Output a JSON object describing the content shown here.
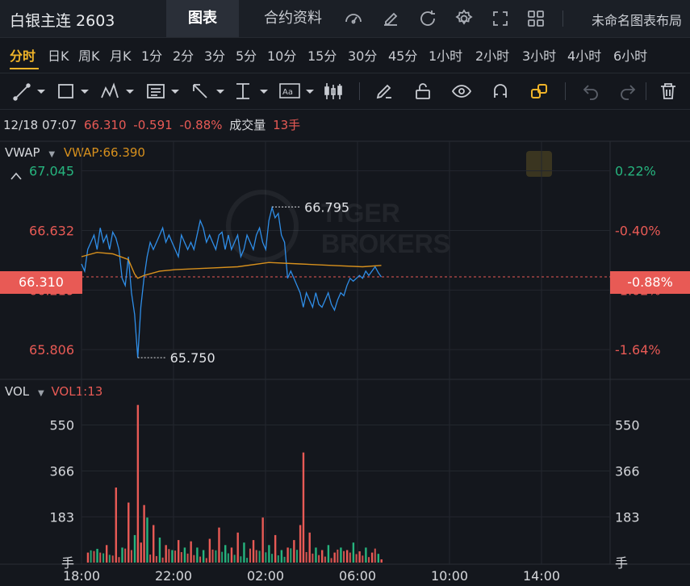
{
  "header": {
    "title": "白银主连 2603",
    "tabs": [
      {
        "label": "图表"
      },
      {
        "label": "合约资料"
      }
    ],
    "toolbar_icons": [
      "gauge-icon",
      "edit-icon",
      "refresh-icon",
      "settings-icon",
      "fullscreen-icon",
      "grid-icon"
    ],
    "layout_name": "未命名图表布局"
  },
  "timeframes": [
    "分时",
    "日K",
    "周K",
    "月K",
    "1分",
    "2分",
    "3分",
    "5分",
    "10分",
    "15分",
    "30分",
    "45分",
    "1小时",
    "2小时",
    "3小时",
    "4小时",
    "6小时"
  ],
  "active_timeframe": "分时",
  "drawing_tools": [
    "line-tool-icon",
    "rectangle-tool-icon",
    "pattern-tool-icon",
    "text-note-tool-icon",
    "arrow-tool-icon",
    "measure-tool-icon",
    "label-tool-icon",
    "candle-tool-icon",
    "pencil-icon",
    "unlock-icon",
    "eye-icon",
    "magnet-icon",
    "link-icon",
    "undo-icon",
    "redo-icon",
    "trash-icon"
  ],
  "info": {
    "datetime": "12/18 07:07",
    "price": "66.310",
    "change": "-0.591",
    "change_pct": "-0.88%",
    "volume_label": "成交量",
    "volume": "13手"
  },
  "indicators": {
    "main_name": "VWAP",
    "main_value": "VWAP:66.390",
    "vol_name": "VOL",
    "vol_value": "VOL1:13"
  },
  "watermark": {
    "line1": "TIGER",
    "line2": "BROKERS"
  },
  "colors": {
    "up": "#26b47e",
    "down": "#e85a55",
    "price_line": "#2f8ee8",
    "vwap_line": "#d7901d",
    "accent": "#f0b429",
    "background": "#14171d"
  },
  "chart_data": [
    {
      "type": "line",
      "title": "分时",
      "x_ticks": [
        "18:00",
        "22:00",
        "02:00",
        "06:00",
        "10:00",
        "14:00"
      ],
      "y_ticks_left": [
        "67.045",
        "66.632",
        "66.219",
        "65.806"
      ],
      "y_ticks_right": [
        "0.22%",
        "-0.40%",
        "-1.02%",
        "-1.64%"
      ],
      "ylim": [
        65.6,
        67.25
      ],
      "current_price": "66.310",
      "current_pct": "-0.88%",
      "annotations": [
        {
          "label": "66.795",
          "x": 61,
          "y": 66.795
        },
        {
          "label": "65.750",
          "x": 18,
          "y": 65.75
        }
      ],
      "series": [
        {
          "name": "price",
          "x": [
            0,
            1,
            2,
            3,
            4,
            5,
            6,
            7,
            8,
            9,
            10,
            11,
            12,
            13,
            14,
            15,
            16,
            17,
            18,
            19,
            20,
            21,
            22,
            23,
            24,
            25,
            26,
            27,
            28,
            29,
            30,
            31,
            32,
            33,
            34,
            35,
            36,
            37,
            38,
            39,
            40,
            41,
            42,
            43,
            44,
            45,
            46,
            47,
            48,
            49,
            50,
            51,
            52,
            53,
            54,
            55,
            56,
            57,
            58,
            59,
            60,
            61,
            62,
            63,
            64,
            65,
            66,
            67,
            68,
            69,
            70,
            71,
            72,
            73,
            74,
            75,
            76,
            77,
            78,
            79,
            80,
            81,
            82,
            83,
            84,
            85,
            86,
            87,
            88,
            89,
            90,
            91,
            92,
            93,
            94,
            95,
            96
          ],
          "y": [
            66.4,
            66.35,
            66.5,
            66.55,
            66.6,
            66.5,
            66.65,
            66.55,
            66.6,
            66.5,
            66.62,
            66.58,
            66.5,
            66.3,
            66.25,
            66.45,
            66.2,
            66.05,
            65.75,
            66.1,
            66.3,
            66.45,
            66.55,
            66.5,
            66.55,
            66.6,
            66.65,
            66.55,
            66.6,
            66.55,
            66.5,
            66.45,
            66.6,
            66.55,
            66.5,
            66.55,
            66.5,
            66.6,
            66.7,
            66.65,
            66.55,
            66.6,
            66.55,
            66.5,
            66.6,
            66.62,
            66.5,
            66.6,
            66.5,
            66.55,
            66.6,
            66.45,
            66.5,
            66.6,
            66.55,
            66.5,
            66.6,
            66.65,
            66.55,
            66.5,
            66.7,
            66.79,
            66.72,
            66.75,
            66.6,
            66.55,
            66.3,
            66.35,
            66.3,
            66.25,
            66.2,
            66.1,
            66.2,
            66.15,
            66.1,
            66.2,
            66.12,
            66.1,
            66.15,
            66.2,
            66.12,
            66.08,
            66.15,
            66.2,
            66.18,
            66.25,
            66.3,
            66.28,
            66.3,
            66.32,
            66.3,
            66.35,
            66.32,
            66.35,
            66.38,
            66.34,
            66.31
          ]
        },
        {
          "name": "VWAP",
          "x": [
            0,
            5,
            10,
            15,
            17,
            18,
            20,
            25,
            30,
            40,
            50,
            60,
            70,
            80,
            90,
            96
          ],
          "y": [
            66.45,
            66.48,
            66.47,
            66.43,
            66.33,
            66.3,
            66.32,
            66.35,
            66.36,
            66.37,
            66.38,
            66.41,
            66.4,
            66.39,
            66.38,
            66.39
          ]
        }
      ]
    },
    {
      "type": "bar",
      "title": "VOL",
      "y_ticks": [
        "550",
        "366",
        "183",
        "手"
      ],
      "ylim": [
        0,
        700
      ],
      "bars": [
        {
          "x": 2,
          "v": 40,
          "d": "down"
        },
        {
          "x": 5,
          "v": 55,
          "d": "up"
        },
        {
          "x": 8,
          "v": 70,
          "d": "down"
        },
        {
          "x": 11,
          "v": 300,
          "d": "down"
        },
        {
          "x": 13,
          "v": 60,
          "d": "up"
        },
        {
          "x": 15,
          "v": 240,
          "d": "down"
        },
        {
          "x": 17,
          "v": 110,
          "d": "up"
        },
        {
          "x": 18,
          "v": 630,
          "d": "down"
        },
        {
          "x": 19,
          "v": 80,
          "d": "down"
        },
        {
          "x": 20,
          "v": 230,
          "d": "down"
        },
        {
          "x": 21,
          "v": 180,
          "d": "up"
        },
        {
          "x": 23,
          "v": 150,
          "d": "down"
        },
        {
          "x": 25,
          "v": 100,
          "d": "up"
        },
        {
          "x": 27,
          "v": 70,
          "d": "down"
        },
        {
          "x": 29,
          "v": 50,
          "d": "up"
        },
        {
          "x": 31,
          "v": 90,
          "d": "down"
        },
        {
          "x": 33,
          "v": 60,
          "d": "up"
        },
        {
          "x": 35,
          "v": 85,
          "d": "down"
        },
        {
          "x": 37,
          "v": 60,
          "d": "up"
        },
        {
          "x": 39,
          "v": 50,
          "d": "up"
        },
        {
          "x": 41,
          "v": 95,
          "d": "down"
        },
        {
          "x": 44,
          "v": 140,
          "d": "down"
        },
        {
          "x": 46,
          "v": 70,
          "d": "up"
        },
        {
          "x": 48,
          "v": 60,
          "d": "down"
        },
        {
          "x": 50,
          "v": 120,
          "d": "down"
        },
        {
          "x": 52,
          "v": 80,
          "d": "up"
        },
        {
          "x": 55,
          "v": 90,
          "d": "down"
        },
        {
          "x": 58,
          "v": 180,
          "d": "down"
        },
        {
          "x": 60,
          "v": 70,
          "d": "up"
        },
        {
          "x": 62,
          "v": 110,
          "d": "down"
        },
        {
          "x": 64,
          "v": 50,
          "d": "up"
        },
        {
          "x": 66,
          "v": 60,
          "d": "down"
        },
        {
          "x": 68,
          "v": 90,
          "d": "down"
        },
        {
          "x": 70,
          "v": 150,
          "d": "down"
        },
        {
          "x": 71,
          "v": 440,
          "d": "down"
        },
        {
          "x": 73,
          "v": 120,
          "d": "down"
        },
        {
          "x": 75,
          "v": 60,
          "d": "up"
        },
        {
          "x": 77,
          "v": 50,
          "d": "down"
        },
        {
          "x": 79,
          "v": 70,
          "d": "up"
        },
        {
          "x": 81,
          "v": 40,
          "d": "down"
        },
        {
          "x": 83,
          "v": 60,
          "d": "up"
        },
        {
          "x": 85,
          "v": 50,
          "d": "down"
        },
        {
          "x": 87,
          "v": 80,
          "d": "up"
        },
        {
          "x": 89,
          "v": 45,
          "d": "down"
        },
        {
          "x": 91,
          "v": 60,
          "d": "up"
        },
        {
          "x": 93,
          "v": 40,
          "d": "down"
        },
        {
          "x": 95,
          "v": 35,
          "d": "up"
        },
        {
          "x": 96,
          "v": 13,
          "d": "down"
        }
      ]
    }
  ]
}
